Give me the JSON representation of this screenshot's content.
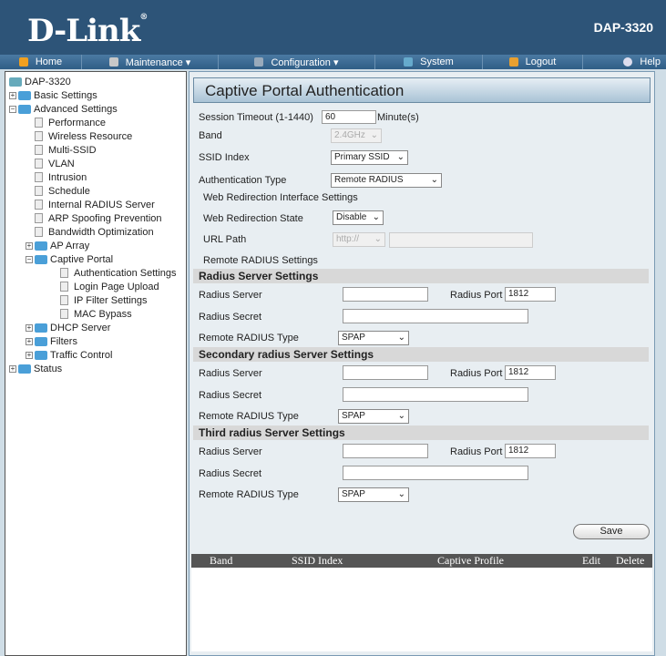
{
  "header": {
    "logo": "D-Link",
    "model": "DAP-3320"
  },
  "nav": [
    {
      "label": "Home",
      "icon": "home-icon"
    },
    {
      "label": "Maintenance ▾",
      "icon": "tools-icon"
    },
    {
      "label": "Configuration ▾",
      "icon": "disk-icon"
    },
    {
      "label": "System",
      "icon": "system-icon"
    },
    {
      "label": "Logout",
      "icon": "key-icon"
    },
    {
      "label": "Help",
      "icon": "help-icon"
    }
  ],
  "tree": {
    "root": "DAP-3320",
    "basic": "Basic Settings",
    "advanced": "Advanced Settings",
    "adv_items": [
      "Performance",
      "Wireless Resource",
      "Multi-SSID",
      "VLAN",
      "Intrusion",
      "Schedule",
      "Internal RADIUS Server",
      "ARP Spoofing Prevention",
      "Bandwidth Optimization"
    ],
    "ap_array": "AP Array",
    "captive": "Captive Portal",
    "captive_items": [
      "Authentication Settings",
      "Login Page Upload",
      "IP Filter Settings",
      "MAC Bypass"
    ],
    "dhcp": "DHCP Server",
    "filters": "Filters",
    "traffic": "Traffic Control",
    "status": "Status"
  },
  "main": {
    "title": "Captive Portal Authentication",
    "session_label": "Session Timeout (1-1440)",
    "session_value": "60",
    "minutes": "Minute(s)",
    "band_label": "Band",
    "band_value": "2.4GHz",
    "ssid_label": "SSID Index",
    "ssid_value": "Primary SSID",
    "auth_label": "Authentication Type",
    "auth_value": "Remote RADIUS",
    "web_heading": "Web Redirection Interface Settings",
    "web_state_label": "Web Redirection State",
    "web_state_value": "Disable",
    "url_label": "URL Path",
    "url_scheme": "http://",
    "url_value": "",
    "remote_heading": "Remote RADIUS Settings",
    "servers": [
      {
        "heading": "Radius Server Settings",
        "server_label": "Radius Server",
        "server": "",
        "port_label": "Radius Port",
        "port": "1812",
        "secret_label": "Radius Secret",
        "secret": "",
        "type_label": "Remote RADIUS Type",
        "type": "SPAP"
      },
      {
        "heading": "Secondary radius Server Settings",
        "server_label": "Radius Server",
        "server": "",
        "port_label": "Radius Port",
        "port": "1812",
        "secret_label": "Radius Secret",
        "secret": "",
        "type_label": "Remote RADIUS Type",
        "type": "SPAP"
      },
      {
        "heading": "Third radius Server Settings",
        "server_label": "Radius Server",
        "server": "",
        "port_label": "Radius Port",
        "port": "1812",
        "secret_label": "Radius Secret",
        "secret": "",
        "type_label": "Remote RADIUS Type",
        "type": "SPAP"
      }
    ],
    "save": "Save",
    "table": {
      "columns": [
        "Band",
        "SSID Index",
        "Captive Profile",
        "Edit",
        "Delete"
      ],
      "rows": []
    }
  }
}
